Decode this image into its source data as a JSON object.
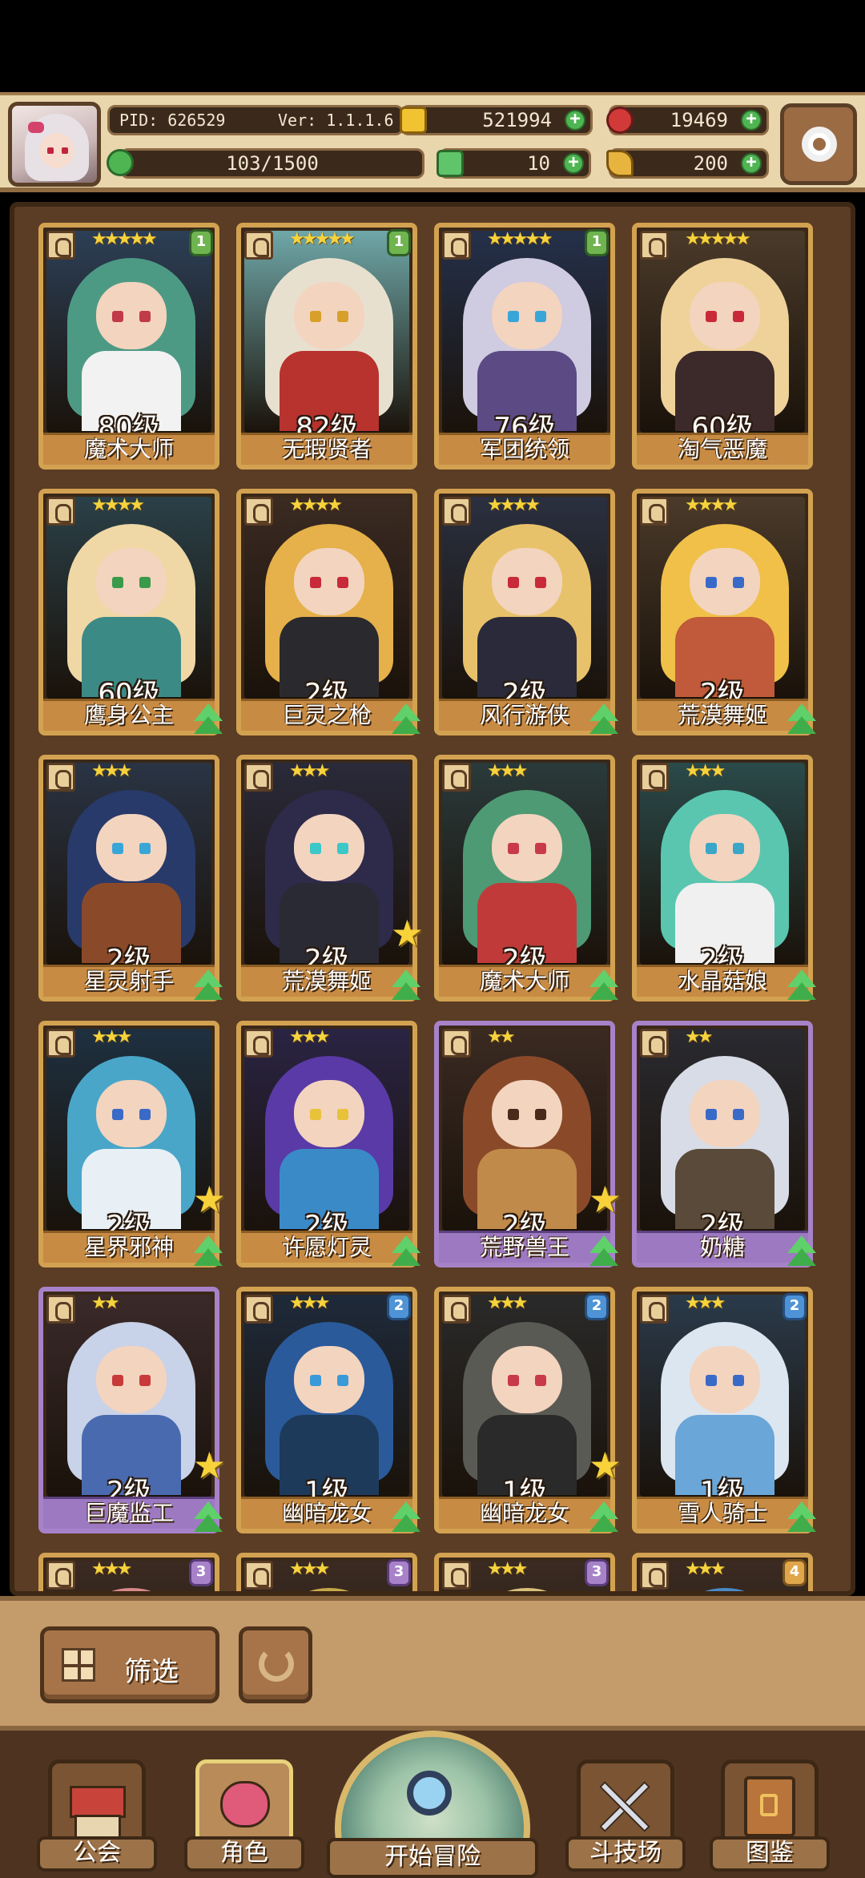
{
  "header": {
    "pid": "PID: 626529",
    "version": "Ver: 1.1.1.6",
    "gold": "521994",
    "gems": "19469",
    "stamina": "103/1500",
    "clovers": "10",
    "keys": "200"
  },
  "roster": [
    {
      "level": "80级",
      "name": "魔术大师",
      "stars": "★★★★★",
      "badge": "1",
      "badge_color": "green",
      "hair": "#4d9a84",
      "body": "#f2f2f2",
      "eye": "#c13a4a",
      "bg": "#2c3f56"
    },
    {
      "level": "82级",
      "name": "无瑕贤者",
      "stars": "★★★★★",
      "badge": "1",
      "badge_color": "green",
      "hair": "#e8e0cf",
      "body": "#b8322e",
      "eye": "#d8a02a",
      "bg": "#6fa7a8"
    },
    {
      "level": "76级",
      "name": "军团统领",
      "stars": "★★★★★",
      "badge": "1",
      "badge_color": "green",
      "hair": "#cfcbe0",
      "body": "#5b4a84",
      "eye": "#38a6d8",
      "bg": "#24304a"
    },
    {
      "level": "60级",
      "name": "淘气恶魔",
      "stars": "★★★★★",
      "badge": "",
      "badge_color": "",
      "hair": "#efd29a",
      "body": "#3c2a2a",
      "eye": "#c82a3a",
      "bg": "#4a3a2a"
    },
    {
      "level": "60级",
      "name": "鹰身公主",
      "stars": "★★★★",
      "badge": "",
      "badge_color": "",
      "hair": "#efd8a6",
      "body": "#3c8a86",
      "eye": "#3a9a4a",
      "bg": "#2a4048"
    },
    {
      "level": "2级",
      "name": "巨灵之枪",
      "stars": "★★★★",
      "badge": "",
      "badge_color": "",
      "hair": "#e6b04a",
      "body": "#2a2a2e",
      "eye": "#c82a3a",
      "bg": "#3a2a22"
    },
    {
      "level": "2级",
      "name": "风行游侠",
      "stars": "★★★★",
      "badge": "",
      "badge_color": "",
      "hair": "#e8c26a",
      "body": "#2a2a3a",
      "eye": "#c82a3a",
      "bg": "#2a3040"
    },
    {
      "level": "2级",
      "name": "荒漠舞姬",
      "stars": "★★★★",
      "badge": "",
      "badge_color": "",
      "hair": "#f0c048",
      "body": "#c05a3a",
      "eye": "#3a6ac8",
      "bg": "#4a3a2a"
    },
    {
      "level": "2级",
      "name": "星灵射手",
      "stars": "★★★",
      "badge": "",
      "badge_color": "",
      "hair": "#283a6a",
      "body": "#8a4a2a",
      "eye": "#3aa6d8",
      "bg": "#2a3444"
    },
    {
      "level": "2级",
      "name": "荒漠舞姬",
      "stars": "★★★",
      "badge": "",
      "badge_color": "",
      "hair": "#2e2a4a",
      "body": "#2a2a34",
      "eye": "#3ac8c8",
      "bg": "#2a2a3a",
      "star": true
    },
    {
      "level": "2级",
      "name": "魔术大师",
      "stars": "★★★",
      "badge": "",
      "badge_color": "",
      "hair": "#4e9a74",
      "body": "#c03a3a",
      "eye": "#c83a4a",
      "bg": "#2a3a3a"
    },
    {
      "level": "2级",
      "name": "水晶菇娘",
      "stars": "★★★",
      "badge": "",
      "badge_color": "",
      "hair": "#5ac6b0",
      "body": "#f0f0f0",
      "eye": "#3aa6c8",
      "bg": "#2a4a4a"
    },
    {
      "level": "2级",
      "name": "星界邪神",
      "stars": "★★★",
      "badge": "",
      "badge_color": "",
      "hair": "#4aa6c8",
      "body": "#e8f0f6",
      "eye": "#3a6ac8",
      "bg": "#1e3040",
      "star": true
    },
    {
      "level": "2级",
      "name": "许愿灯灵",
      "stars": "★★★",
      "badge": "",
      "badge_color": "",
      "hair": "#5a3aa6",
      "body": "#3a8ac8",
      "eye": "#e8c23a",
      "bg": "#2a2444"
    },
    {
      "level": "2级",
      "name": "荒野兽王",
      "stars": "★★",
      "badge": "",
      "badge_color": "",
      "hair": "#8a4a2a",
      "body": "#c08a4a",
      "eye": "#4a2a1a",
      "bg": "#3a2a22",
      "purple": true,
      "star": true
    },
    {
      "level": "2级",
      "name": "奶糖",
      "stars": "★★",
      "badge": "",
      "badge_color": "",
      "hair": "#d8dce6",
      "body": "#5a4a3a",
      "eye": "#3a6ac8",
      "bg": "#2a2a30",
      "purple": true
    },
    {
      "level": "2级",
      "name": "巨魔监工",
      "stars": "★★",
      "badge": "",
      "badge_color": "",
      "hair": "#c8d2e8",
      "body": "#4a6ab0",
      "eye": "#c83a3a",
      "bg": "#3a2a2a",
      "purple": true,
      "star": true
    },
    {
      "level": "1级",
      "name": "幽暗龙女",
      "stars": "★★★",
      "badge": "2",
      "badge_color": "blue",
      "hair": "#2a5a9a",
      "body": "#1e3a5a",
      "eye": "#3a9ad8",
      "bg": "#1e2a3a"
    },
    {
      "level": "1级",
      "name": "幽暗龙女",
      "stars": "★★★",
      "badge": "2",
      "badge_color": "blue",
      "hair": "#5a5a54",
      "body": "#2a2a2a",
      "eye": "#c83a4a",
      "bg": "#2a2a2a",
      "star": true
    },
    {
      "level": "1级",
      "name": "雪人骑士",
      "stars": "★★★",
      "badge": "2",
      "badge_color": "blue",
      "hair": "#dce6f0",
      "body": "#6aa6d8",
      "eye": "#3a6ac8",
      "bg": "#2a3a4a"
    },
    {
      "level": "",
      "name": "",
      "stars": "★★★",
      "badge": "3",
      "badge_color": "purple",
      "hair": "#d88a8a",
      "body": "#3a2a22",
      "eye": "#3a2a22",
      "bg": "#3a2a22"
    },
    {
      "level": "",
      "name": "",
      "stars": "★★★",
      "badge": "3",
      "badge_color": "purple",
      "hair": "#c8a84a",
      "body": "#3a2a22",
      "eye": "#3a2a22",
      "bg": "#3a2a22"
    },
    {
      "level": "",
      "name": "",
      "stars": "★★★",
      "badge": "3",
      "badge_color": "purple",
      "hair": "#d8c07a",
      "body": "#3a2a22",
      "eye": "#3a2a22",
      "bg": "#3a2a22"
    },
    {
      "level": "",
      "name": "",
      "stars": "★★★",
      "badge": "4",
      "badge_color": "gold",
      "hair": "#4a8ac8",
      "body": "#3a2a22",
      "eye": "#3a2a22",
      "bg": "#3a2a22"
    }
  ],
  "filter": {
    "label": "筛选"
  },
  "nav": {
    "guild": "公会",
    "characters": "角色",
    "adventure": "开始冒险",
    "arena": "斗技场",
    "codex": "图鉴"
  },
  "colors": {
    "accent_gold": "#d3a251",
    "rarity_purple": "#a782c9",
    "panel_brown": "#5a3d24"
  }
}
